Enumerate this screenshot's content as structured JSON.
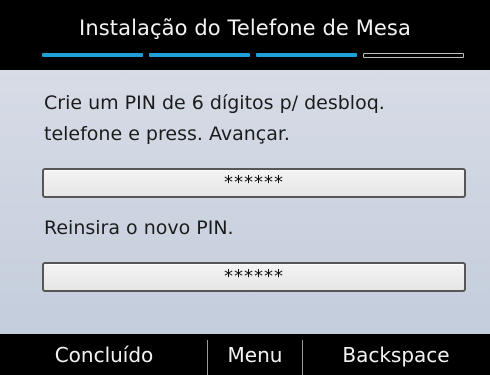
{
  "header": {
    "title": "Instalação do Telefone de Mesa",
    "progress": {
      "total_steps": 4,
      "completed_steps": 3,
      "accent_color": "#1e9fd8"
    }
  },
  "main": {
    "instruction": "Crie um PIN de 6 dígitos p/ desbloq. telefone e press. Avançar.",
    "pin_field_value": "******",
    "reenter_label": "Reinsira o novo PIN.",
    "confirm_pin_field_value": "******"
  },
  "softkeys": {
    "done_label": "Concluído",
    "menu_label": "Menu",
    "backspace_label": "Backspace"
  }
}
